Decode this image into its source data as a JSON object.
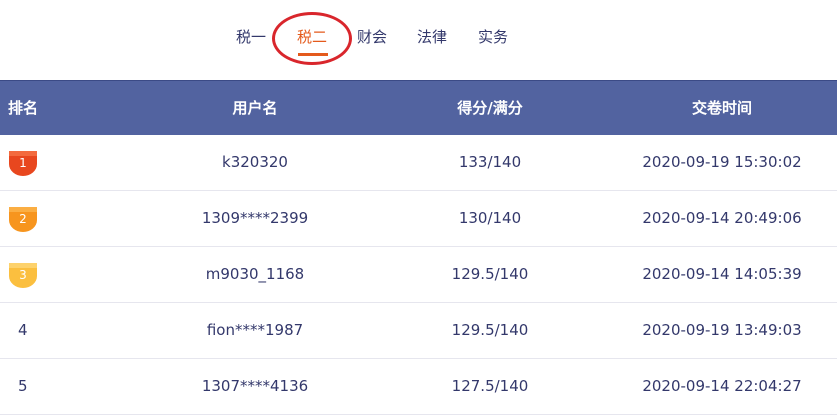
{
  "tabs": [
    {
      "label": "税一"
    },
    {
      "label": "税二",
      "active": true
    },
    {
      "label": "财会"
    },
    {
      "label": "法律"
    },
    {
      "label": "实务"
    }
  ],
  "table": {
    "headers": [
      "排名",
      "用户名",
      "得分/满分",
      "交卷时间"
    ],
    "rows": [
      {
        "rank": "1",
        "user": "k320320",
        "score": "133/140",
        "time": "2020-09-19 15:30:02",
        "medal": "gold-red"
      },
      {
        "rank": "2",
        "user": "1309****2399",
        "score": "130/140",
        "time": "2020-09-14 20:49:06",
        "medal": "orange"
      },
      {
        "rank": "3",
        "user": "m9030_1168",
        "score": "129.5/140",
        "time": "2020-09-14 14:05:39",
        "medal": "yellow"
      },
      {
        "rank": "4",
        "user": "fion****1987",
        "score": "129.5/140",
        "time": "2020-09-19 13:49:03"
      },
      {
        "rank": "5",
        "user": "1307****4136",
        "score": "127.5/140",
        "time": "2020-09-14 22:04:27"
      }
    ]
  },
  "colors": {
    "header_bg": "#5263a0",
    "active_tab": "#e45a1c",
    "highlight_ring": "#d9262c",
    "text": "#33386b"
  }
}
